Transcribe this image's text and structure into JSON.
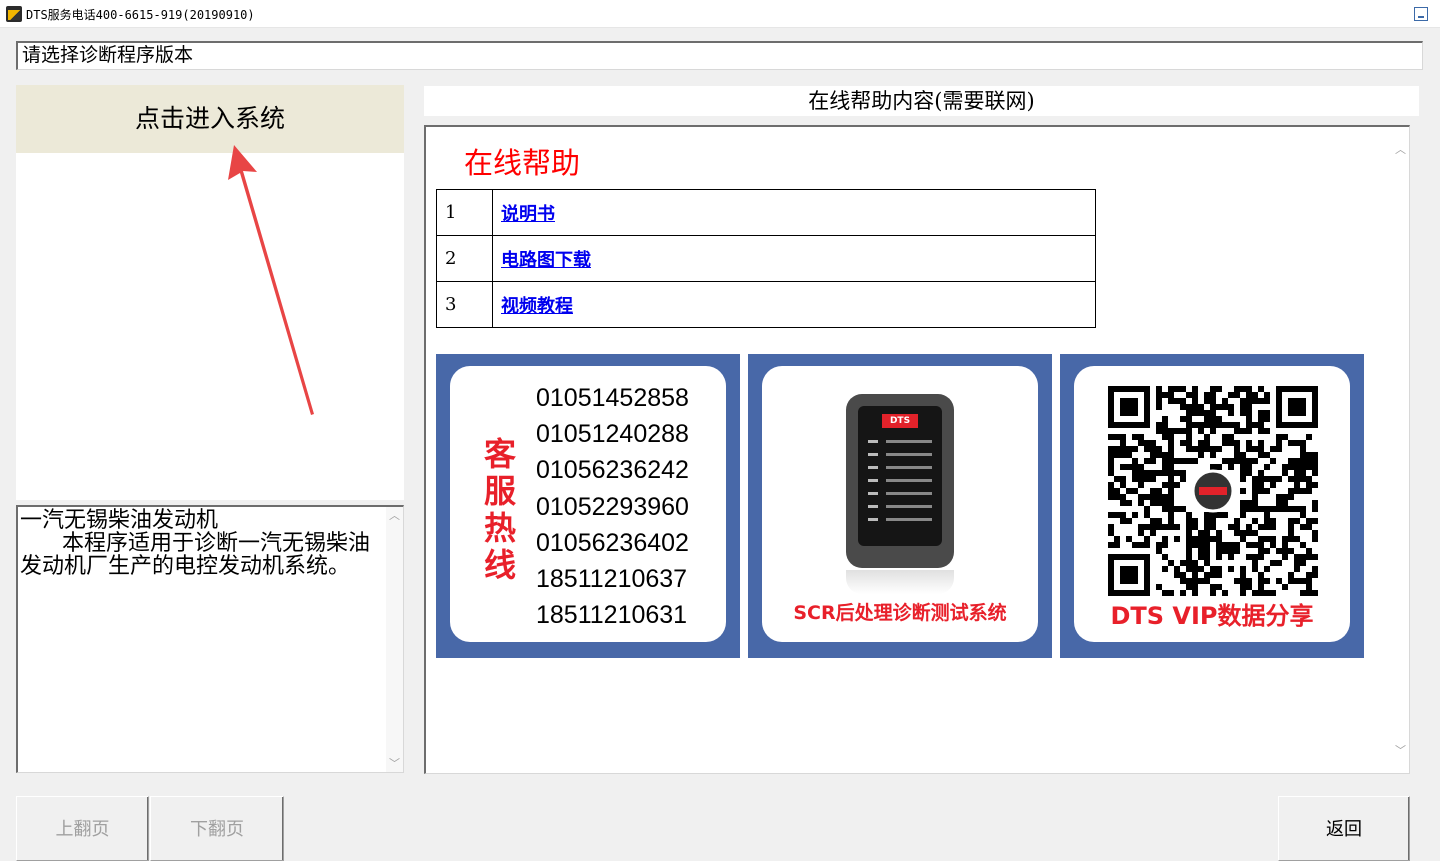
{
  "window": {
    "title": "DTS服务电话400-6615-919(20190910)"
  },
  "version_selector": {
    "label": "请选择诊断程序版本"
  },
  "left_panel": {
    "enter_button": "点击进入系统",
    "description": "一汽无锡柴油发动机\n      本程序适用于诊断一汽无锡柴油发动机厂生产的电控发动机系统。"
  },
  "help": {
    "header": "在线帮助内容(需要联网)",
    "title": "在线帮助",
    "links": [
      {
        "num": "1",
        "label": "说明书"
      },
      {
        "num": "2",
        "label": "电路图下载"
      },
      {
        "num": "3",
        "label": "视频教程"
      }
    ],
    "banners": {
      "hotline": {
        "label": "客服热线",
        "phones": [
          "01051452858",
          "01051240288",
          "01056236242",
          "01052293960",
          "01056236402",
          "18511210637",
          "18511210631"
        ]
      },
      "scr": {
        "device_logo": "DTS",
        "caption": "SCR后处理诊断测试系统"
      },
      "vip": {
        "caption": "DTS VIP数据分享"
      }
    }
  },
  "footer": {
    "prev_page": "上翻页",
    "next_page": "下翻页",
    "back": "返回"
  },
  "colors": {
    "accent_red": "#e8202a",
    "banner_blue": "#4868a8",
    "link_blue": "#0000ee",
    "button_beige": "#ece9d8"
  },
  "icons": [
    "app-icon",
    "minimize-icon",
    "scroll-up-icon",
    "scroll-down-icon",
    "red-arrow-icon",
    "qr-code-icon"
  ]
}
